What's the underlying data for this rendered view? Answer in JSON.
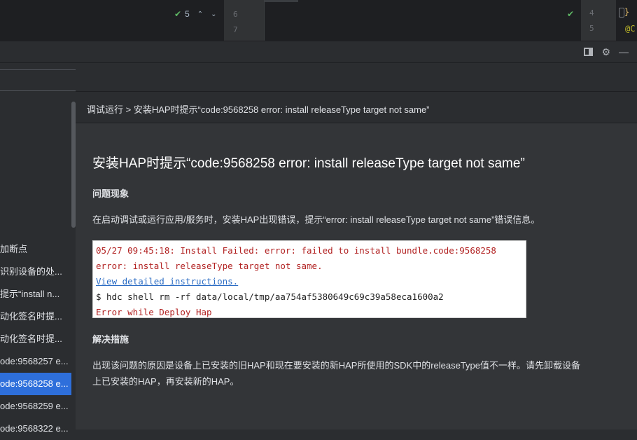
{
  "editor": {
    "inspection_count": "5",
    "mid_lines": [
      "6",
      "7"
    ],
    "right_lines": [
      "4",
      "5"
    ],
    "right_brace": "}",
    "right_annotation": "@C"
  },
  "tool_window": {
    "icons": [
      "layout-icon",
      "gear-icon",
      "minimize-icon"
    ]
  },
  "search": {
    "placeholder": ""
  },
  "nav": {
    "items": [
      {
        "label": "加断点",
        "selected": false
      },
      {
        "label": "识别设备的处...",
        "selected": false
      },
      {
        "label": "提示“install n...",
        "selected": false
      },
      {
        "label": "动化签名时提...",
        "selected": false
      },
      {
        "label": "动化签名时提...",
        "selected": false
      },
      {
        "label": "ode:9568257 e...",
        "selected": false
      },
      {
        "label": "ode:9568258 e...",
        "selected": true
      },
      {
        "label": "ode:9568259 e...",
        "selected": false
      },
      {
        "label": "ode:9568322 e...",
        "selected": false
      }
    ]
  },
  "breadcrumb": "调试运行 > 安装HAP时提示“code:9568258 error: install releaseType target not same”",
  "doc": {
    "title": "安装HAP时提示“code:9568258 error: install releaseType target not same”",
    "section1_heading": "问题现象",
    "section1_text": "在启动调试或运行应用/服务时，安装HAP出现错误，提示“error: install releaseType target not same”错误信息。",
    "code": {
      "line1": "05/27 09:45:18: Install Failed: error: failed to install bundle.code:9568258",
      "line2": "error: install releaseType target not same.",
      "link": "View detailed instructions.",
      "line4": "$ hdc shell rm -rf data/local/tmp/aa754af5380649c69c39a58eca1600a2",
      "line5": "Error while Deploy Hap"
    },
    "section2_heading": "解决措施",
    "section2_line1": "出现该问题的原因是设备上已安装的旧HAP和现在要安装的新HAP所使用的SDK中的releaseType值不一样。请先卸载设备",
    "section2_line2": "上已安装的HAP，再安装新的HAP。"
  },
  "colors": {
    "selection": "#2e6fdb",
    "error_text": "#b22222",
    "link": "#2b6cc4",
    "check": "#5fb865"
  }
}
